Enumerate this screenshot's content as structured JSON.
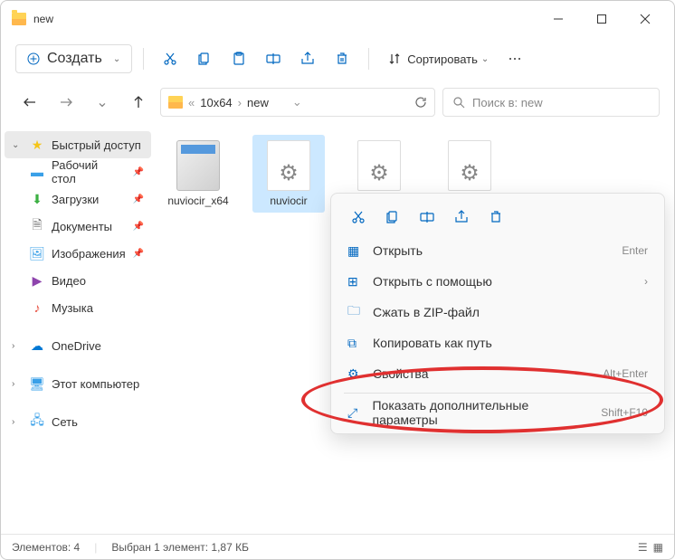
{
  "window": {
    "title": "new"
  },
  "toolbar": {
    "create": "Создать",
    "sort": "Сортировать"
  },
  "address": {
    "prefix": "«",
    "part1": "10x64",
    "part2": "new"
  },
  "search": {
    "placeholder": "Поиск в: new"
  },
  "sidebar": {
    "quick_access": "Быстрый доступ",
    "desktop": "Рабочий стол",
    "downloads": "Загрузки",
    "documents": "Документы",
    "pictures": "Изображения",
    "video": "Видео",
    "music": "Музыка",
    "onedrive": "OneDrive",
    "this_pc": "Этот компьютер",
    "network": "Сеть"
  },
  "files": {
    "f1": "nuviocir_x64",
    "f2": "nuviocir"
  },
  "context": {
    "open": "Открыть",
    "open_with": "Открыть с помощью",
    "compress_zip": "Сжать в ZIP-файл",
    "copy_path": "Копировать как путь",
    "properties": "Свойства",
    "show_more": "Показать дополнительные параметры",
    "sc_enter": "Enter",
    "sc_alt_enter": "Alt+Enter",
    "sc_shift_f10": "Shift+F10"
  },
  "status": {
    "count": "Элементов: 4",
    "selection": "Выбран 1 элемент: 1,87 КБ"
  }
}
